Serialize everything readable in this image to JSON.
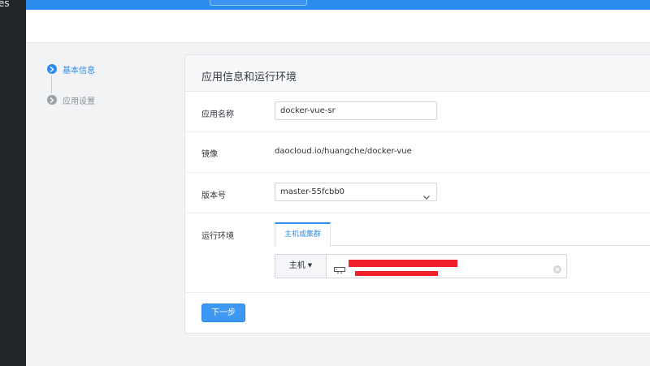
{
  "left_rail": {
    "partial_text": "es"
  },
  "steps": [
    {
      "label": "基本信息",
      "state": "active"
    },
    {
      "label": "应用设置",
      "state": "inactive"
    }
  ],
  "panel": {
    "title": "应用信息和运行环境",
    "app_name": {
      "label": "应用名称",
      "value": "docker-vue-sr"
    },
    "image": {
      "label": "镜像",
      "value": "daocloud.io/huangche/docker-vue"
    },
    "version": {
      "label": "版本号",
      "selected": "master-55fcbb0"
    },
    "runtime": {
      "label": "运行环境",
      "tab": "主机或集群",
      "host_select": "主机"
    },
    "next_button": "下一步"
  },
  "colors": {
    "accent": "#2b8cf0",
    "redaction": "#f0202a",
    "sidebar": "#22262b"
  }
}
